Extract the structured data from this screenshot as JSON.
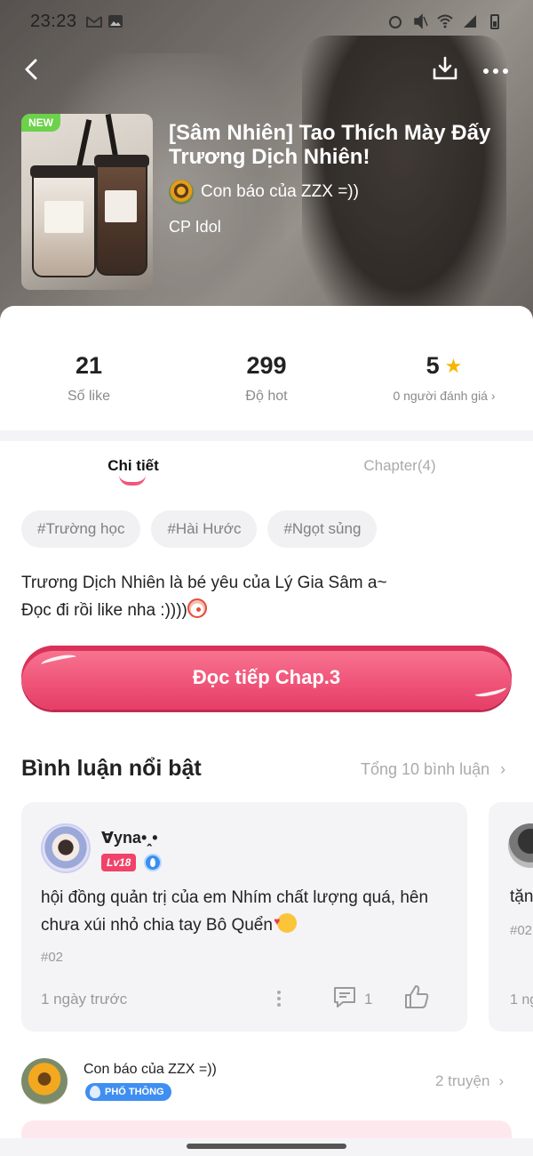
{
  "status_bar": {
    "time": "23:23"
  },
  "header": {
    "badge_new": "NEW",
    "title": "[Sâm Nhiên] Tao Thích Mày Đấy Trương Dịch Nhiên!",
    "author": "Con báo của ZZX =))",
    "category": "CP Idol"
  },
  "stats": {
    "likes": {
      "value": "21",
      "label": "Số like"
    },
    "hot": {
      "value": "299",
      "label": "Độ hot"
    },
    "rating": {
      "value": "5",
      "label": "0 người đánh giá"
    }
  },
  "tabs": [
    {
      "label": "Chi tiết",
      "active": true
    },
    {
      "label": "Chapter(4)",
      "active": false
    }
  ],
  "tags": [
    "#Trường học",
    "#Hài Hước",
    "#Ngọt sủng"
  ],
  "description": {
    "line1": "Trương Dịch Nhiên là bé yêu của Lý Gia Sâm a~",
    "line2": " Đọc đi rồi like nha :))))"
  },
  "cta": {
    "label": "Đọc tiếp Chap.3"
  },
  "comments_section": {
    "title": "Bình luận nổi bật",
    "total_link": "Tổng 10 bình luận",
    "items": [
      {
        "user": "ꓯyna•ꞈ•",
        "level": "Lv18",
        "text": "hội đồng quản trị của em Nhím chất lượng quá, hên chưa xúi nhỏ chia tay Bô Quển",
        "ref": "#02",
        "time": "1 ngày trước",
        "reply_count": "1"
      }
    ],
    "peek": {
      "text": "tặn",
      "ref": "#02",
      "time": "1 ng"
    }
  },
  "author_bar": {
    "name": "Con báo của ZZX =))",
    "badge": "PHỔ THÔNG",
    "stories_link": "2 truyện"
  },
  "colors": {
    "accent": "#f0567a",
    "star": "#f7b500",
    "new_badge": "#6bd24a"
  }
}
